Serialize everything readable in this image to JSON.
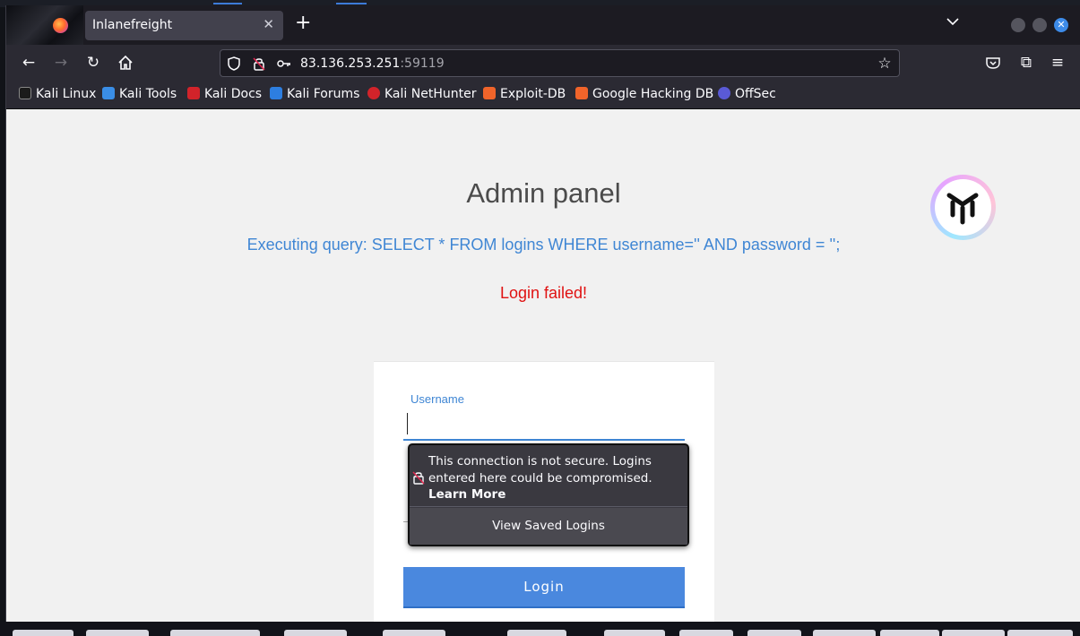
{
  "browser": {
    "tab_title": "Inlanefreight",
    "url_host": "83.136.253.251",
    "url_port": ":59119"
  },
  "bookmarks": [
    {
      "label": "Kali Linux",
      "color": "#1b1b1b"
    },
    {
      "label": "Kali Tools",
      "color": "#3a8ee6"
    },
    {
      "label": "Kali Docs",
      "color": "#d2232a"
    },
    {
      "label": "Kali Forums",
      "color": "#2d7ee0"
    },
    {
      "label": "Kali NetHunter",
      "color": "#d2232a"
    },
    {
      "label": "Exploit-DB",
      "color": "#f0642a"
    },
    {
      "label": "Google Hacking DB",
      "color": "#f0642a"
    },
    {
      "label": "OffSec",
      "color": "#5a5ad6"
    }
  ],
  "page": {
    "title": "Admin panel",
    "query": "Executing query: SELECT * FROM logins WHERE username='' AND password = '';",
    "status": "Login failed!",
    "username_label": "Username",
    "login_button": "Login"
  },
  "popup": {
    "message": "This connection is not secure. Logins entered here could be compromised.",
    "learn_more": "Learn More",
    "view_saved": "View Saved Logins"
  }
}
